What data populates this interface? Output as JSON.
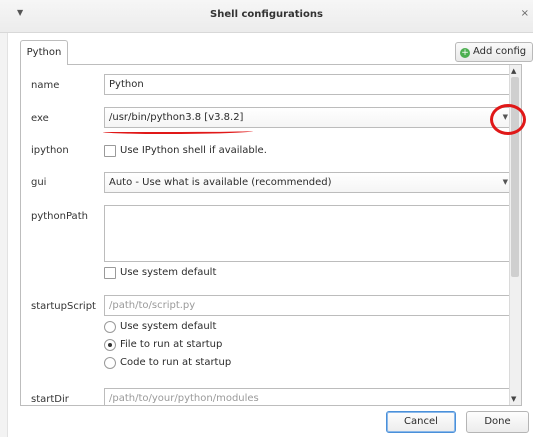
{
  "window": {
    "title": "Shell configurations",
    "menu_icon": "chevron-down-icon",
    "close_label": "×"
  },
  "tabs": [
    {
      "label": "Python"
    }
  ],
  "add_config_label": "Add config",
  "form": {
    "name": {
      "label": "name",
      "value": "Python"
    },
    "exe": {
      "label": "exe",
      "value": "/usr/bin/python3.8  [v3.8.2]"
    },
    "ipython": {
      "label": "ipython",
      "checkbox_label": "Use IPython shell if available.",
      "checked": false
    },
    "gui": {
      "label": "gui",
      "value": "Auto  -  Use what is available (recommended)"
    },
    "pythonPath": {
      "label": "pythonPath",
      "value": "",
      "checkbox_label": "Use system default",
      "checked": false
    },
    "startupScript": {
      "label": "startupScript",
      "placeholder": "/path/to/script.py",
      "options": [
        "Use system default",
        "File to run at startup",
        "Code to run at startup"
      ],
      "selected": "File to run at startup"
    },
    "startDir": {
      "label": "startDir",
      "placeholder": "/path/to/your/python/modules"
    }
  },
  "buttons": {
    "cancel": "Cancel",
    "done": "Done"
  },
  "annotations": {
    "color": "#e01818"
  }
}
